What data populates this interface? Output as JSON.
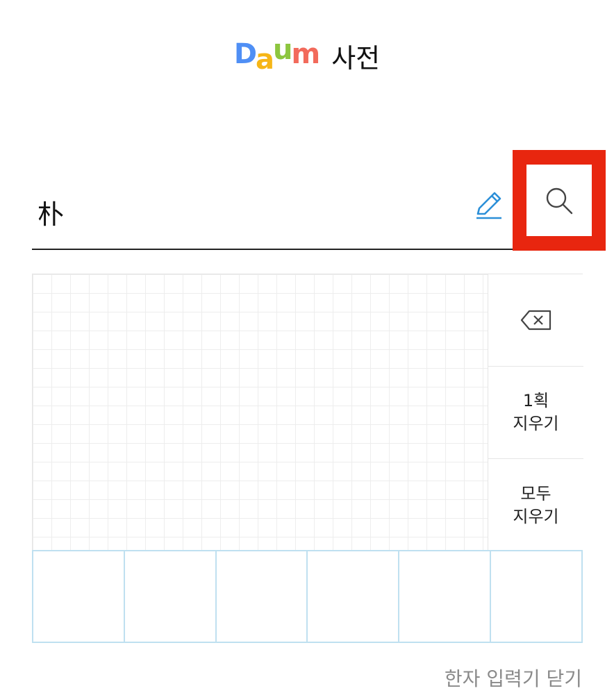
{
  "header": {
    "logo_letters": [
      {
        "char": "D",
        "color": "#4f8ff5"
      },
      {
        "char": "a",
        "color": "#f6b617"
      },
      {
        "char": "u",
        "color": "#8dc63f"
      },
      {
        "char": "m",
        "color": "#f26a5b"
      }
    ],
    "site_name": "사전"
  },
  "search": {
    "value": "朴",
    "pen_icon": "pen-icon",
    "search_icon": "search-icon",
    "highlight_color": "#e8260f",
    "pen_color": "#2b8fd8"
  },
  "handwriting_pad": {
    "side_buttons": [
      {
        "label_lines": [],
        "icon": "backspace-icon"
      },
      {
        "label_lines": [
          "1획",
          "지우기"
        ]
      },
      {
        "label_lines": [
          "모두",
          "지우기"
        ]
      }
    ],
    "candidates": [
      "",
      "",
      "",
      "",
      "",
      ""
    ]
  },
  "footer": {
    "close_label": "한자 입력기 닫기"
  }
}
